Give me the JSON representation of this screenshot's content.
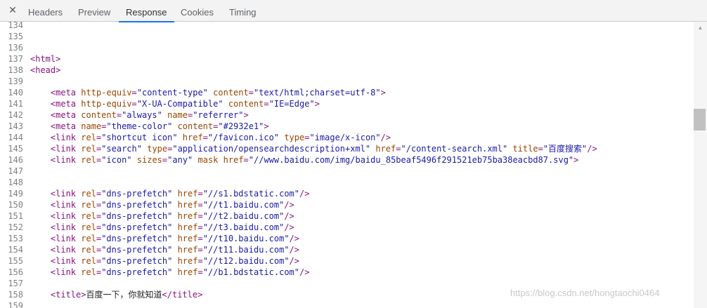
{
  "toolbar": {
    "close_symbol": "✕",
    "tabs": [
      {
        "label": "Headers",
        "active": false
      },
      {
        "label": "Preview",
        "active": false
      },
      {
        "label": "Response",
        "active": true
      },
      {
        "label": "Cookies",
        "active": false
      },
      {
        "label": "Timing",
        "active": false
      }
    ]
  },
  "colors": {
    "tag": "#881280",
    "attribute": "#994500",
    "value": "#1a1aa6",
    "line_number": "#808080",
    "active_tab_underline": "#1a73e8"
  },
  "code_lines": [
    {
      "n": "134",
      "text": ""
    },
    {
      "n": "135",
      "text": ""
    },
    {
      "n": "136",
      "text": ""
    },
    {
      "n": "137",
      "text": "<html>"
    },
    {
      "n": "138",
      "text": "<head>"
    },
    {
      "n": "139",
      "text": ""
    },
    {
      "n": "140",
      "text": "    <meta http-equiv=\"content-type\" content=\"text/html;charset=utf-8\">"
    },
    {
      "n": "141",
      "text": "    <meta http-equiv=\"X-UA-Compatible\" content=\"IE=Edge\">"
    },
    {
      "n": "142",
      "text": "    <meta content=\"always\" name=\"referrer\">"
    },
    {
      "n": "143",
      "text": "    <meta name=\"theme-color\" content=\"#2932e1\">"
    },
    {
      "n": "144",
      "text": "    <link rel=\"shortcut icon\" href=\"/favicon.ico\" type=\"image/x-icon\" />"
    },
    {
      "n": "145",
      "text": "    <link rel=\"search\" type=\"application/opensearchdescription+xml\" href=\"/content-search.xml\" title=\"百度搜索\" />"
    },
    {
      "n": "146",
      "text": "    <link rel=\"icon\" sizes=\"any\" mask href=\"//www.baidu.com/img/baidu_85beaf5496f291521eb75ba38eacbd87.svg\">"
    },
    {
      "n": "147",
      "text": ""
    },
    {
      "n": "148",
      "text": ""
    },
    {
      "n": "149",
      "text": "    <link rel=\"dns-prefetch\" href=\"//s1.bdstatic.com\"/>"
    },
    {
      "n": "150",
      "text": "    <link rel=\"dns-prefetch\" href=\"//t1.baidu.com\"/>"
    },
    {
      "n": "151",
      "text": "    <link rel=\"dns-prefetch\" href=\"//t2.baidu.com\"/>"
    },
    {
      "n": "152",
      "text": "    <link rel=\"dns-prefetch\" href=\"//t3.baidu.com\"/>"
    },
    {
      "n": "153",
      "text": "    <link rel=\"dns-prefetch\" href=\"//t10.baidu.com\"/>"
    },
    {
      "n": "154",
      "text": "    <link rel=\"dns-prefetch\" href=\"//t11.baidu.com\"/>"
    },
    {
      "n": "155",
      "text": "    <link rel=\"dns-prefetch\" href=\"//t12.baidu.com\"/>"
    },
    {
      "n": "156",
      "text": "    <link rel=\"dns-prefetch\" href=\"//b1.bdstatic.com\"/>"
    },
    {
      "n": "157",
      "text": ""
    },
    {
      "n": "158",
      "text": "    <title>百度一下，你就知道</title>"
    },
    {
      "n": "159",
      "text": ""
    }
  ],
  "watermark": "https://blog.csdn.net/hongtaochi0464"
}
